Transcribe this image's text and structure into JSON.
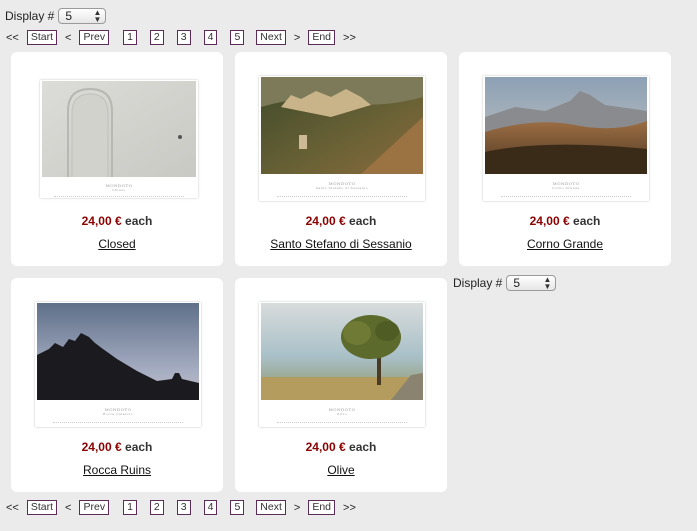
{
  "display": {
    "label": "Display #",
    "value": "5"
  },
  "pager": {
    "first_symbol": "<<",
    "start": "Start",
    "prev_symbol": "<",
    "prev": "Prev",
    "pages": [
      "1",
      "2",
      "3",
      "4",
      "5"
    ],
    "next": "Next",
    "next_symbol": ">",
    "end": "End",
    "last_symbol": ">>"
  },
  "products": [
    {
      "price": "24,00 €",
      "each": "each",
      "title": "Closed",
      "caption": "MONDOTO",
      "caption2": "Chiuso"
    },
    {
      "price": "24,00 €",
      "each": "each",
      "title": "Santo Stefano di Sessanio",
      "caption": "MONDOTO",
      "caption2": "Santo Stefano di Sessanio"
    },
    {
      "price": "24,00 €",
      "each": "each",
      "title": "Corno Grande",
      "caption": "MONDOTO",
      "caption2": "Corno Grande"
    },
    {
      "price": "24,00 €",
      "each": "each",
      "title": "Rocca Ruins",
      "caption": "MONDOTO",
      "caption2": "Rocca Calascio"
    },
    {
      "price": "24,00 €",
      "each": "each",
      "title": "Olive",
      "caption": "MONDOTO",
      "caption2": "Olivo"
    }
  ]
}
